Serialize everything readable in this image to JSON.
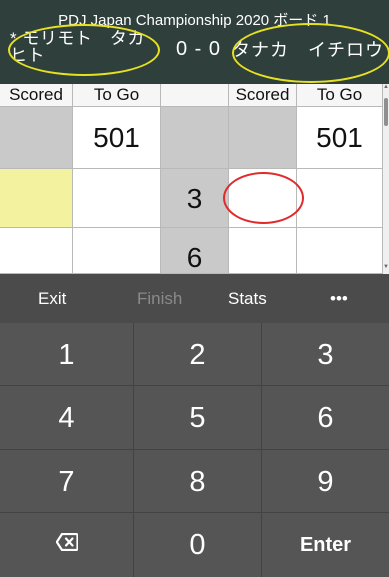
{
  "header": {
    "title": "PDJ Japan Championship 2020 ボード 1",
    "player1": "* モリモト　タカヒト",
    "score": "0 - 0",
    "player2": "タナカ　イチロウ"
  },
  "table": {
    "headers": [
      "Scored",
      "To Go",
      "",
      "Scored",
      "To Go"
    ],
    "player1_to_go": "501",
    "player2_to_go": "501",
    "darts": [
      "3",
      "6"
    ]
  },
  "toolbar": {
    "exit": "Exit",
    "finish": "Finish",
    "stats": "Stats",
    "more": "•••"
  },
  "keypad": {
    "keys": [
      "1",
      "2",
      "3",
      "4",
      "5",
      "6",
      "7",
      "8",
      "9",
      "",
      "0",
      "Enter"
    ]
  },
  "colors": {
    "header_bg": "#2f3f3c",
    "keypad_bg": "#555555",
    "toolbar_bg": "#4b4b4b",
    "highlight_yellow": "#f3f29e",
    "annotation_yellow": "#e6e21f",
    "annotation_red": "#e12a2a"
  }
}
